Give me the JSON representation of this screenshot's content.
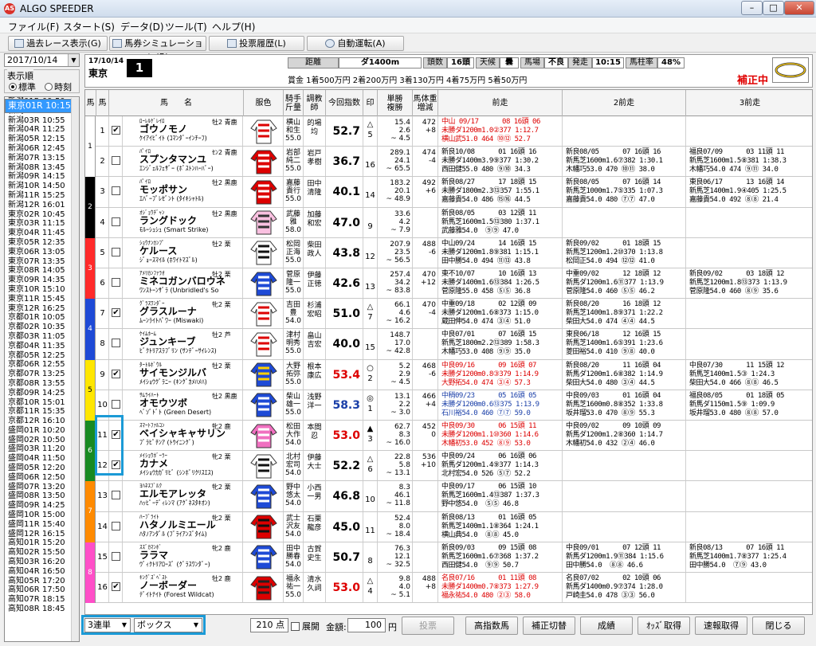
{
  "app": {
    "title": "ALGO SPEEDER"
  },
  "menu": [
    "ファイル(F)",
    "スタート(S)",
    "データ(D)",
    "ツール(T)",
    "ヘルプ(H)"
  ],
  "toolbar": {
    "past": "過去レース表示(G)",
    "sim": "馬券シミュレーション(B)",
    "hist": "投票履歴(L)",
    "auto": "自動運転(A)"
  },
  "left": {
    "date": "2017/10/14",
    "order_title": "表示順",
    "opt_std": "標準",
    "opt_time": "時刻",
    "races": [
      "新潟01R 09:50",
      "新潟02R 10:25",
      "新潟03R 10:55",
      "新潟04R 11:25",
      "新潟05R 12:15",
      "新潟06R 12:45",
      "新潟07R 13:15",
      "新潟08R 13:45",
      "新潟09R 14:15",
      "新潟10R 14:50",
      "新潟11R 15:25",
      "新潟12R 16:01",
      "東京01R 10:15",
      "東京02R 10:45",
      "東京03R 11:15",
      "東京04R 11:45",
      "東京05R 12:35",
      "東京06R 13:05",
      "東京07R 13:35",
      "東京08R 14:05",
      "東京09R 14:35",
      "東京10R 15:10",
      "東京11R 15:45",
      "東京12R 16:25",
      "京都01R 10:05",
      "京都02R 10:35",
      "京都03R 11:05",
      "京都04R 11:35",
      "京都05R 12:25",
      "京都06R 12:55",
      "京都07R 13:25",
      "京都08R 13:55",
      "京都09R 14:25",
      "京都10R 15:01",
      "京都11R 15:35",
      "京都12R 16:10",
      "盛岡01R 10:20",
      "盛岡02R 10:50",
      "盛岡03R 11:20",
      "盛岡04R 11:50",
      "盛岡05R 12:20",
      "盛岡06R 12:50",
      "盛岡07R 13:20",
      "盛岡08R 13:50",
      "盛岡09R 14:25",
      "盛岡10R 15:00",
      "盛岡11R 15:40",
      "盛岡12R 16:15",
      "高知01R 15:20",
      "高知02R 15:50",
      "高知03R 16:20",
      "高知04R 16:50",
      "高知05R 17:20",
      "高知06R 17:50",
      "高知07R 18:15",
      "高知08R 18:45"
    ],
    "selected_index": 12
  },
  "header": {
    "date": "17/10/14",
    "venue": "東京",
    "race": "1",
    "dist_label": "距離",
    "dist": "ダ1400m",
    "count_label": "頭数",
    "count": "16頭",
    "weather_label": "天候",
    "weather": "曇",
    "track_label": "馬場",
    "going": "不良",
    "post_label": "発走",
    "post": "10:15",
    "rate_label": "馬柱率",
    "rate": "48%",
    "prize": "賞金 1着500万円  2着200万円  3着130万円  4着75万円  5着50万円",
    "corr": "補正中"
  },
  "cols": [
    "馬",
    "馬",
    "馬　　名",
    "服色",
    "騎手\n斤量",
    "調教\n師",
    "今回指数",
    "印",
    "単勝\n複勝",
    "馬体重\n増減",
    "前走",
    "2前走",
    "3前走"
  ],
  "horses": [
    {
      "f": "1",
      "n": "1",
      "chk": "✔",
      "sire": "ﾛｰﾚﾙｹﾞﾚｲﾛ",
      "name": "ゴウノモノ",
      "dam": "ｹｲｱｲﾋﾞｲﾄ (ｺﾏﾝﾀﾞｰｲﾝﾁｰﾌ)",
      "sex": "牡2 青鹿",
      "jock": "横山\n和生\n55.0",
      "trn": "的場\n均",
      "idx": "52.7",
      "icol": "#000",
      "mark": "△\n5",
      "odds": "15.4\n2.6\n~ 4.5",
      "wt": "472\n+8",
      "r1": "中山 09/17      08 16頭 06\n未勝ダ1200m1.0②377 1:12.7\n横山武51.0 464 ⑩⑫ 52.7",
      "r1c": "#d00",
      "r2": "",
      "r3": ""
    },
    {
      "f": "1",
      "n": "2",
      "chk": "",
      "sire": "ﾊﾟｲﾛ",
      "name": "スプンタマンユ",
      "dam": "ｴﾝｼﾞｪﾙﾌｪｻﾞｰ (ﾎﾞｽﾄﾝﾊｰﾊﾞｰ)",
      "sex": "ｾﾝ2 青鹿",
      "jock": "岩部\n純二\n55.0",
      "trn": "岩戸\n孝樹",
      "idx": "36.7",
      "icol": "#000",
      "mark": "\n16",
      "odds": "289.1\n24.1\n~ 65.5",
      "wt": "474\n-4",
      "r1": "新良10/08      01 16頭 16\n未勝ダ1400m3.9⑨377 1:30.2\n西田健55.0 480 ⑨⑩ 34.3",
      "r1c": "#000",
      "r2": "新良08/05      07 16頭 16\n新馬芝1600m1.6⑦382 1:30.1\n木幡巧53.0 470 ⑩⑪ 38.0",
      "r3": "福良07/09      03 11頭 11\n新馬芝1600m1.5⑧381 1:38.3\n木幡巧54.0 474 ⑨⑪ 34.0"
    },
    {
      "f": "2",
      "n": "3",
      "chk": "",
      "sire": "ﾊﾟｲﾛ",
      "name": "モッポサン",
      "dam": "ｴﾊﾞｰﾌﾟﾚｾﾞﾝﾄ (ﾀｲｷｼｬﾄﾙ)",
      "sex": "牡2 黒鹿",
      "jock": "嘉藤\n貴行\n55.0",
      "trn": "田中\n清隆",
      "idx": "40.1",
      "icol": "#000",
      "mark": "\n14",
      "odds": "183.2\n20.1\n~ 48.9",
      "wt": "492\n+6",
      "r1": "新良08/27      17 18頭 15\n未勝ダ1800m2.3⑬357 1:55.1\n嘉藤貴54.0 486 ⑮⑯ 44.5",
      "r1c": "#000",
      "r2": "新良08/05      07 16頭 14\n新馬芝1000m1.7⑤335 1:07.3\n嘉藤貴54.0 480 ⑦⑦ 47.0",
      "r3": "東良06/17      13 16頭 14\n新馬芝1400m1.9④405 1:25.5\n嘉藤貴54.0 492 ⑧⑧ 21.4"
    },
    {
      "f": "2",
      "n": "4",
      "chk": "",
      "sire": "ｵｼﾞｮｳﾁﾞｬﾝ",
      "name": "ラングドック",
      "dam": "ﾓﾙｰｼｭｼｭ (Smart Strike)",
      "sex": "牡2 黒鹿",
      "jock": "武藤\n雅\n58.0",
      "trn": "加藤\n和宏",
      "idx": "47.0",
      "icol": "#000",
      "mark": "\n9",
      "odds": "33.6\n4.2\n~ 7.9",
      "wt": "\n",
      "r1": "新良08/05      03 12頭 11\n新馬芝1600m1.5⑬380 1:37.1\n武藤雅54.0  ⑨⑨ 47.0",
      "r1c": "#000",
      "r2": "",
      "r3": ""
    },
    {
      "f": "3",
      "n": "5",
      "chk": "",
      "sire": "ｼｮｳﾅﾝｶﾝﾌﾟ",
      "name": "ケルース",
      "dam": "ｼﾞｮｰｽﾏｲﾙ (ﾎﾜｲﾄﾏｽﾞﾙ)",
      "sex": "牡2 栗",
      "jock": "松岡\n正海\n55.0",
      "trn": "柴田\n政人",
      "idx": "43.8",
      "icol": "#000",
      "mark": "\n12",
      "odds": "207.9\n23.5\n~ 56.5",
      "wt": "488\n-6",
      "r1": "中山09/24      14 16頭 15\n未勝ダ1200m1.8⑨381 1:15.1\n田中勝54.0 494 ⑪⑬ 43.8",
      "r1c": "#000",
      "r2": "新良09/02      01 18頭 15\n新馬芝1200m1.2⑩370 1:13.8\n松岡正54.0 494 ⑫⑫ 41.0",
      "r3": ""
    },
    {
      "f": "3",
      "n": "6",
      "chk": "",
      "sire": "ｱﾒﾘｶﾝﾌｧﾗｵ",
      "name": "ミネコガンバロウネ",
      "dam": "ﾜﾝｽﾄｰﾝｻﾞﾗ (Unbridled's So",
      "sex": "牡2 栗",
      "jock": "菅原\n隆一\n55.0",
      "trn": "伊藤\n正徳",
      "idx": "42.6",
      "icol": "#000",
      "mark": "\n13",
      "odds": "257.4\n34.2\n~ 83.8",
      "wt": "470\n+12",
      "r1": "東不10/07      10 16頭 13\n未勝ダ1400m1.6⑬384 1:26.5\n菅原隆55.0 458 ⑤⑤ 36.8",
      "r1c": "#000",
      "r2": "中重09/02      12 18頭 12\n新馬ダ1200m1.6⑪377 1:13.9\n菅原隆54.0 460 ⑤⑤ 46.2",
      "r3": "新良09/02      03 18頭 12\n新馬芝1200m1.8⑬373 1:13.9\n菅原隆54.0 460 ⑧⑨ 35.6"
    },
    {
      "f": "4",
      "n": "7",
      "chk": "✔",
      "sire": "ｸﾞﾗｽﾜﾝﾀﾞｰ",
      "name": "グラスルーナ",
      "dam": "ﾑｰﾝﾗｲﾄﾊﾟﾜｰ (Miswaki)",
      "sex": "牝2 栗",
      "jock": "吉田\n豊\n54.0",
      "trn": "杉浦\n宏昭",
      "idx": "51.0",
      "icol": "#000",
      "mark": "△\n7",
      "odds": "66.1\n4.6\n~ 16.2",
      "wt": "470\n-4",
      "r1": "中重09/18      02 12頭 09\n未勝ダ1200m1.6⑧373 1:15.0\n蔵田伸54.0 474 ③④ 51.0",
      "r1c": "#000",
      "r2": "新良08/20      16 18頭 12\n新馬芝1400m1.8⑨371 1:22.2\n柴田大54.0 474 ④④ 44.5",
      "r3": ""
    },
    {
      "f": "4",
      "n": "8",
      "chk": "",
      "sire": "ｹｲﾑﾎｰﾑ",
      "name": "ジュンキーブ",
      "dam": "ﾋﾞｸﾄﾘｱｽﾗﾌﾞﾘﾝ (ｻﾝﾃﾞｰｻｲﾚﾝｽ)",
      "sex": "牡2 芦",
      "jock": "津村\n明秀\n55.0",
      "trn": "畠山\n吉宏",
      "idx": "40.0",
      "icol": "#000",
      "mark": "\n15",
      "odds": "148.7\n17.0\n~ 42.8",
      "wt": "\n",
      "r1": "中良07/01      07 16頭 15\n新馬芝1800m2.2⑬389 1:58.3\n木幡巧53.0 408 ⑨⑨ 35.0",
      "r1c": "#000",
      "r2": "東良06/18      12 16頭 15\n新馬芝1400m1.6⑤391 1:23.6\n菱田裕54.0 410 ⑨⑧ 40.0",
      "r3": ""
    },
    {
      "f": "5",
      "n": "9",
      "chk": "✔",
      "sire": "ﾀｰﾄﾙﾎﾞｳﾙ",
      "name": "サイモンジルバ",
      "dam": "ﾒｲｼｮｳｸﾞﾗﾆｰ (ｷﾝｸﾞｶﾒﾊﾒﾊ)",
      "sex": "牡2 栗",
      "jock": "大野\n拓弥\n55.0",
      "trn": "根本\n康広",
      "idx": "53.4",
      "icol": "#d00",
      "mark": "○\n2",
      "odds": "5.2\n2.9\n~ 4.5",
      "wt": "468\n-6",
      "r1": "中良09/16      09 16頭 07\n未勝ダ1200m0.8③379 1:14.9\n大野拓54.0 474 ③④ 57.3",
      "r1c": "#d00",
      "r2": "新良08/20      11 16頭 04\n新馬ダ1200m1.6⑧382 1:14.9\n柴田大54.0 480 ③④ 44.5",
      "r3": "中良07/30      11 15頭 12\n新馬芝1400m1.5③ 1:24.3\n柴田大54.0 466 ⑧⑧ 46.5"
    },
    {
      "f": "5",
      "n": "10",
      "chk": "",
      "sire": "ｻﾑﾗｲﾊｰﾄ",
      "name": "オモウツボ",
      "dam": "ﾍﾞｿﾞﾄﾞﾄ (Green Desert)",
      "sex": "牡2 黒鹿",
      "jock": "柴山\n雄一\n55.0",
      "trn": "浅野\n洋一",
      "idx": "58.3",
      "icol": "#1a3fa8",
      "mark": "◎\n1",
      "odds": "13.1\n2.2\n~ 3.0",
      "wt": "466\n+4",
      "r1": "中稍09/23      05 16頭 05\n未勝ダ1200m0.6⑬375 1:13.9\n石川裕54.0 460 ⑦⑦ 59.0",
      "r1c": "#1a3fa8",
      "r2": "中良09/03      01 16頭 04\n新馬芝1600m0.8⑧352 1:33.8\n坂井瑠53.0 470 ⑧⑨ 55.3",
      "r3": "福良08/05      01 18頭 05\n新馬ダ1150m1.5⑨ 1:09.9\n坂井瑠53.0 480 ⑧⑧ 57.0"
    },
    {
      "f": "6",
      "n": "11",
      "chk": "✔",
      "sire": "ｽﾏｰﾄﾌｧﾙｺﾝ",
      "name": "ベイシャキャサリン",
      "dam": "ﾌﾞﾗﾋﾟﾁﾝｱ (ﾄｳｲﾆﾝｸﾞ)",
      "sex": "牝2 鹿",
      "jock": "松田\n大作\n54.0",
      "trn": "本間\n忍",
      "idx": "53.0",
      "icol": "#d00",
      "mark": "▲\n3",
      "odds": "62.7\n8.3\n~ 16.0",
      "wt": "452\n0",
      "r1": "中良09/30      06 15頭 11\n未勝ダ1200m1.1⑩360 1:14.6\n木幡初53.0 452 ⑧⑨ 53.0",
      "r1c": "#d00",
      "r2": "中良09/02      09 10頭 09\n新馬ダ1200m1.2⑧360 1:14.7\n木幡初54.0 432 ②④ 46.0",
      "r3": ""
    },
    {
      "f": "6",
      "n": "12",
      "chk": "✔",
      "sire": "ﾒｲｼｮｳﾎﾞｰﾗｰ",
      "name": "カナメ",
      "dam": "ﾒｲｼｮｳｶｶﾞﾘﾋﾞ (ｼﾝﾎﾞﾘｸﾘｽｴｽ)",
      "sex": "牝2 栗",
      "jock": "北村\n宏司\n54.0",
      "trn": "伊藤\n大士",
      "idx": "52.2",
      "icol": "#000",
      "mark": "△\n6",
      "odds": "22.8\n5.8\n~ 13.1",
      "wt": "536\n+10",
      "r1": "中良09/24      06 16頭 06\n新馬ダ1200m1.4⑨377 1:14.3\n北村宏54.0 526 ⑤⑦ 52.2",
      "r1c": "#000",
      "r2": "",
      "r3": ""
    },
    {
      "f": "7",
      "n": "13",
      "chk": "",
      "sire": "ﾖﾊﾈｽﾌﾞﾙｸ",
      "name": "エルモアレッタ",
      "dam": "ﾊｯﾋﾟｰﾃﾞｨﾚﾝﾏ (ｱｸﾞﾈｽﾀｷｵﾝ)",
      "sex": "牝2 栗",
      "jock": "野中\n悠太\n54.0",
      "trn": "小西\n一男",
      "idx": "46.8",
      "icol": "#000",
      "mark": "\n10",
      "odds": "8.3\n46.1\n~ 11.8",
      "wt": "\n",
      "r1": "中良09/17      06 15頭 10\n新馬芝1600m1.4⑬387 1:37.3\n野中悠54.0  ⑤⑤ 46.8",
      "r1c": "#000",
      "r2": "",
      "r3": ""
    },
    {
      "f": "7",
      "n": "14",
      "chk": "",
      "sire": "ﾊｰﾌﾞﾗｲﾄ",
      "name": "ハタノルミエール",
      "dam": "ﾊﾀﾉｱﾝﾀﾞﾙ (ﾌﾞﾗｲｱﾝｽﾞﾀｲﾑ)",
      "sex": "牝2 栗",
      "jock": "武士\n沢友\n54.0",
      "trn": "石栗\n龍彦",
      "idx": "45.0",
      "icol": "#000",
      "mark": "\n11",
      "odds": "52.4\n8.0\n~ 18.4",
      "wt": "\n",
      "r1": "新良08/13      01 16頭 05\n新馬芝1400m1.1⑧364 1:24.1\n横山典54.0  ⑧⑧ 45.0",
      "r1c": "#000",
      "r2": "",
      "r3": ""
    },
    {
      "f": "8",
      "n": "15",
      "chk": "",
      "sire": "ｽｽﾞｶﾏﾝﾎﾞ",
      "name": "ララマ",
      "dam": "ｳﾞｨｸﾄﾘｱﾛｰｽﾞ (ｸﾞﾗｽﾜﾝﾀﾞｰ)",
      "sex": "牝2 鹿",
      "jock": "田中\n勝春\n54.0",
      "trn": "古賀\n史生",
      "idx": "50.7",
      "icol": "#000",
      "mark": "\n8",
      "odds": "76.3\n12.1\n~ 32.5",
      "wt": "\n",
      "r1": "新良09/03      09 15頭 08\n新馬芝1600m1.6⑦368 1:37.2\n西田健54.0  ⑨⑨ 50.7",
      "r1c": "#000",
      "r2": "中良09/01      07 12頭 11\n新馬ダ1200m1.9⑪384 1:15.6\n田中勝54.0  ⑧⑧ 46.6",
      "r3": "新良08/13      07 16頭 11\n新馬芝1400m1.7⑧377 1:25.4\n田中勝54.0  ⑦⑨ 43.0"
    },
    {
      "f": "8",
      "n": "16",
      "chk": "✔",
      "sire": "ｷﾝｸﾞｽﾞﾍﾞｽﾄ",
      "name": "ノーボーダー",
      "dam": "ﾃﾞｲﾄﾅｲﾄ (Forest Wildcat)",
      "sex": "牡2 鹿",
      "jock": "福永\n祐一\n55.0",
      "trn": "清水\n久詞",
      "idx": "53.0",
      "icol": "#d00",
      "mark": "△\n4",
      "odds": "9.8\n4.0\n~ 5.1",
      "wt": "488\n+8",
      "r1": "名良07/16      01 11頭 08\n未勝ダ1400m0.7⑧373 1:27.9\n福永祐54.0 480 ②③ 58.0",
      "r1c": "#d00",
      "r2": "名良07/02      02 10頭 06\n新馬ダ1400m0.9⑦374 1:28.0\n戸崎圭54.0 478 ③③ 56.0",
      "r3": ""
    }
  ],
  "bottom": {
    "bet": "3連単",
    "type": "ボックス",
    "points": "210 点",
    "expand": "展開",
    "amount_label": "金額:",
    "amount": "100",
    "yen": "円",
    "vote": "投票",
    "b1": "高指数馬",
    "b2": "補正切替",
    "b3": "成績",
    "b4": "ｵｯｽﾞ取得",
    "b5": "速報取得",
    "b6": "閉じる"
  },
  "colors": {
    "frame": {
      "1": "#ffffff",
      "2": "#000000",
      "3": "#ff2a2a",
      "4": "#1e4ad6",
      "5": "#ffe600",
      "6": "#188a22",
      "7": "#ff8a00",
      "8": "#ff4fc8"
    },
    "accent": "#1b9ad6",
    "select": "#3399ff"
  }
}
